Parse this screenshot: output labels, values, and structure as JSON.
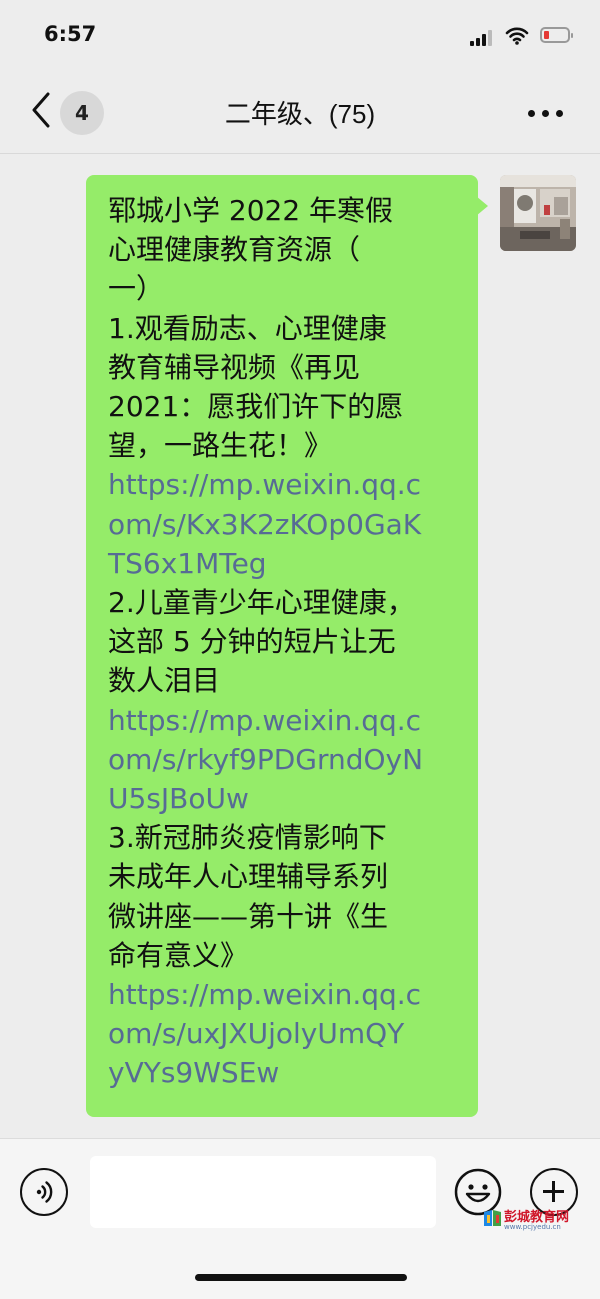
{
  "status_bar": {
    "time": "6:57",
    "battery_color": "#e53935"
  },
  "nav": {
    "back_icon": "chevron-left-icon",
    "unread_badge": "4",
    "title": "二年级、(75)",
    "more_icon": "more-dots-icon"
  },
  "message": {
    "bubble_color": "#95ec69",
    "link_color": "#576b95",
    "lines": [
      {
        "text": "郓城小学 2022 年寒假",
        "type": "text"
      },
      {
        "text": "心理健康教育资源（",
        "type": "text"
      },
      {
        "text": "一）",
        "type": "text"
      },
      {
        "text": "1.观看励志、心理健康",
        "type": "text"
      },
      {
        "text": "教育辅导视频《再见",
        "type": "text"
      },
      {
        "text": "2021：愿我们许下的愿",
        "type": "text"
      },
      {
        "text": "望，一路生花！》",
        "type": "text"
      },
      {
        "text": "https://mp.weixin.qq.c",
        "type": "link"
      },
      {
        "text": "om/s/Kx3K2zKOp0GaK",
        "type": "link"
      },
      {
        "text": "TS6x1MTeg",
        "type": "link"
      },
      {
        "text": "2.儿童青少年心理健康，",
        "type": "text"
      },
      {
        "text": "这部 5 分钟的短片让无",
        "type": "text"
      },
      {
        "text": "数人泪目",
        "type": "text"
      },
      {
        "text": "https://mp.weixin.qq.c",
        "type": "link"
      },
      {
        "text": "om/s/rkyf9PDGrndOyN",
        "type": "link"
      },
      {
        "text": "U5sJBoUw",
        "type": "link"
      },
      {
        "text": "3.新冠肺炎疫情影响下",
        "type": "text"
      },
      {
        "text": "未成年人心理辅导系列",
        "type": "text"
      },
      {
        "text": "微讲座——第十讲《生",
        "type": "text"
      },
      {
        "text": "命有意义》",
        "type": "text"
      },
      {
        "text": "https://mp.weixin.qq.c",
        "type": "link"
      },
      {
        "text": "om/s/uxJXUjolyUmQY",
        "type": "link"
      },
      {
        "text": "yVYs9WSEw",
        "type": "link"
      }
    ]
  },
  "input_bar": {
    "voice_icon": "voice-icon",
    "emoji_icon": "emoji-icon",
    "plus_icon": "plus-icon"
  },
  "watermark": {
    "title": "彭城教育网",
    "url": "www.pcjyedu.cn"
  }
}
